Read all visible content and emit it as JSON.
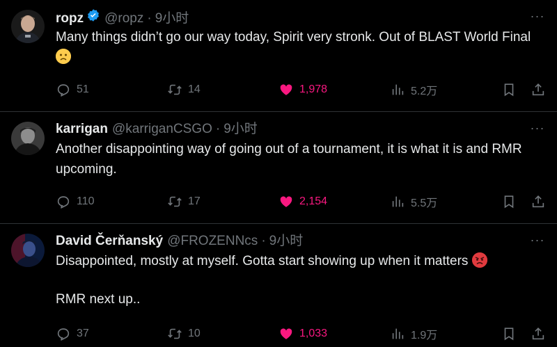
{
  "tweets": [
    {
      "name": "ropz",
      "verified": true,
      "handle": "@ropz",
      "dot": "·",
      "time": "9小时",
      "text": "Many things didn’t go our way today, Spirit very stronk. Out of BLAST World Final ",
      "emoji": "slightly-frowning-face",
      "replies": "51",
      "retweets": "14",
      "likes": "1,978",
      "views": "5.2万"
    },
    {
      "name": "karrigan",
      "verified": false,
      "handle": "@karriganCSGO",
      "dot": "·",
      "time": "9小时",
      "text": "Another disappointing way of going out of a tournament, it is what it is and RMR upcoming.",
      "replies": "110",
      "retweets": "17",
      "likes": "2,154",
      "views": "5.5万"
    },
    {
      "name": "David Čerňanský",
      "verified": false,
      "handle": "@FROZENNcs",
      "dot": "·",
      "time": "9小时",
      "text": "Disappointed, mostly at myself. Gotta start showing up when it matters ",
      "text2": "RMR next up..",
      "emoji": "angry-face",
      "replies": "37",
      "retweets": "10",
      "likes": "1,033",
      "views": "1.9万"
    }
  ],
  "more_label": "···",
  "colors": {
    "background": "#000000",
    "text": "#e7e9ea",
    "muted": "#71767b",
    "like": "#f91880",
    "verified": "#1d9bf0",
    "divider": "#2f3336"
  },
  "icons": [
    "verified-badge-icon",
    "more-icon",
    "reply-icon",
    "retweet-icon",
    "heart-icon",
    "views-icon",
    "bookmark-icon",
    "share-icon"
  ]
}
